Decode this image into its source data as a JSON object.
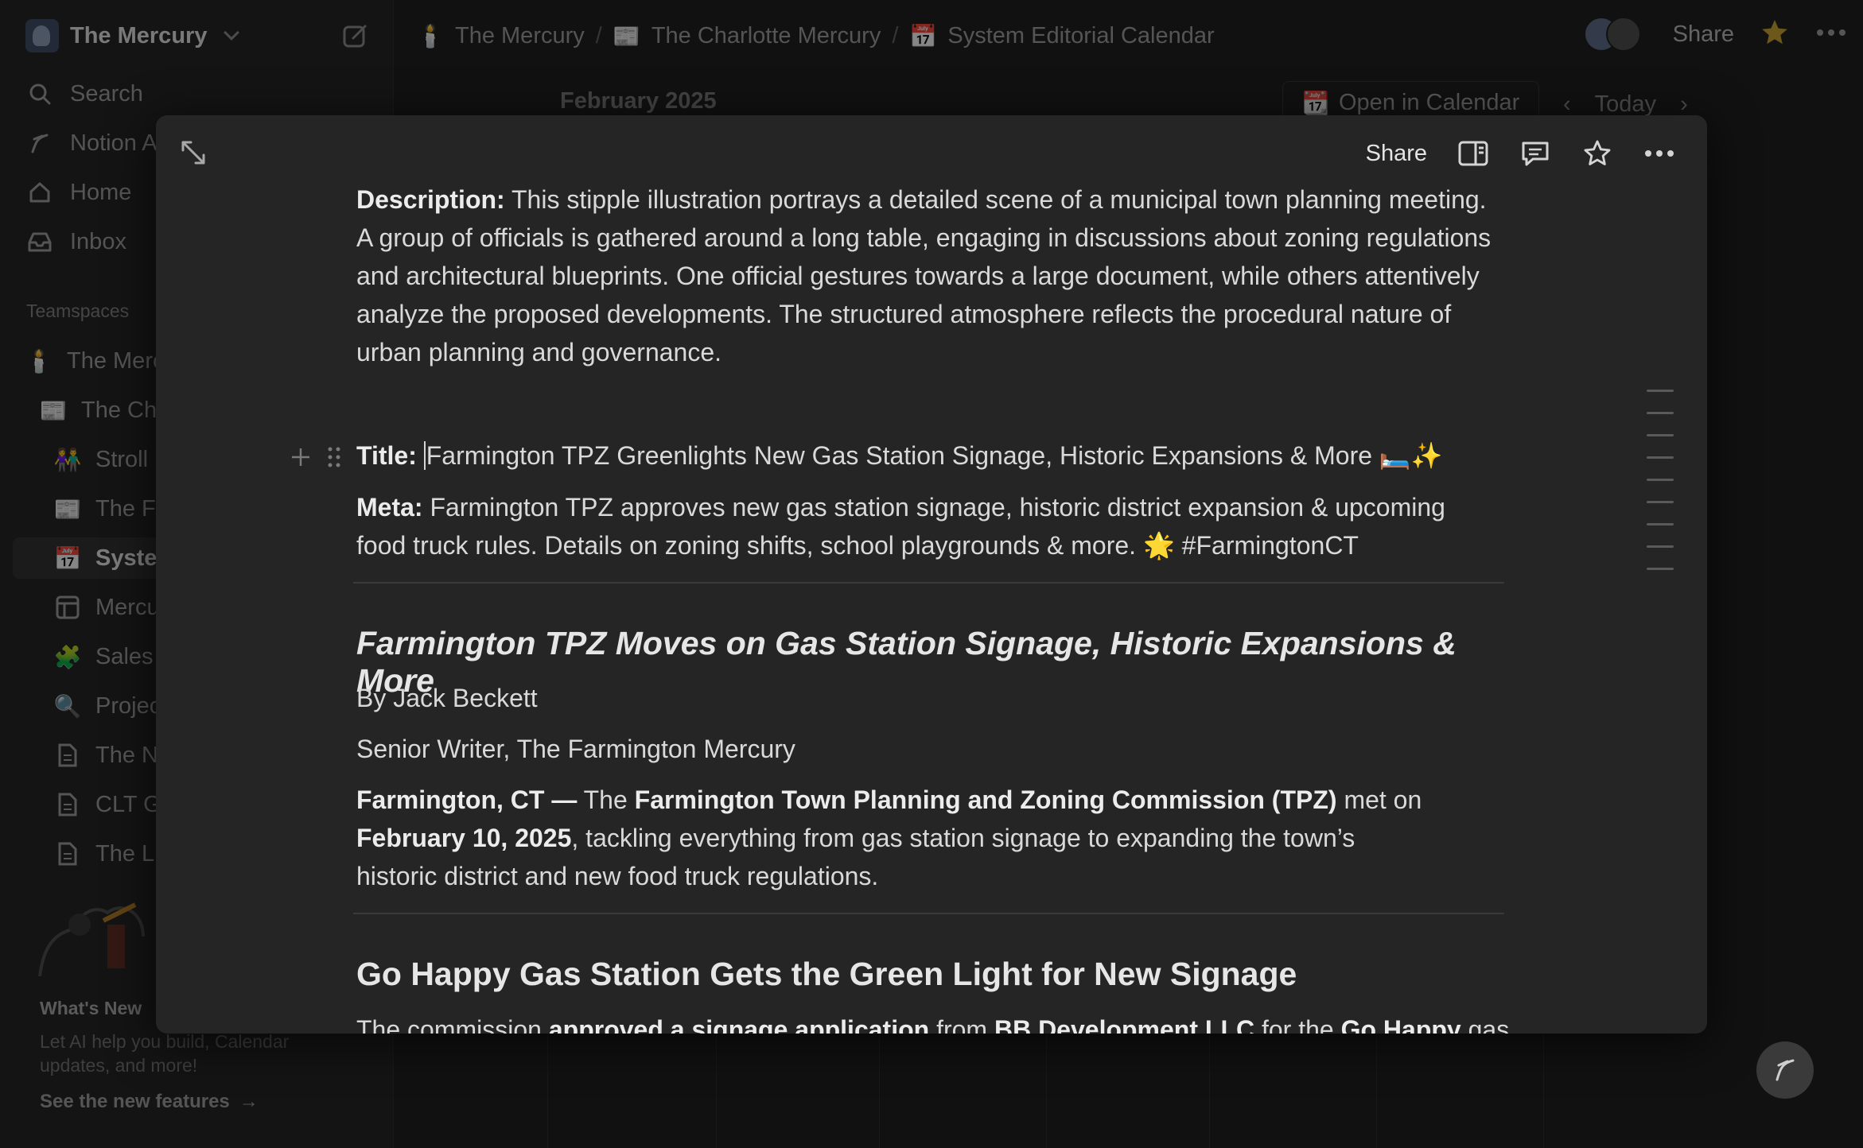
{
  "workspace": {
    "name": "The Mercury"
  },
  "sidebar": {
    "nav": [
      {
        "label": "Search",
        "icon": "search-icon"
      },
      {
        "label": "Notion AI",
        "icon": "notion-ai-icon"
      },
      {
        "label": "Home",
        "icon": "home-icon"
      },
      {
        "label": "Inbox",
        "icon": "inbox-icon"
      }
    ],
    "teamspaces_label": "Teamspaces",
    "teamspaces": [
      {
        "label": "The Mercury",
        "icon": "🕯️"
      },
      {
        "label": "The Charlotte Mercury",
        "icon": "📰"
      },
      {
        "label": "Stroll",
        "icon": "👫"
      },
      {
        "label": "The F",
        "icon": "📰"
      },
      {
        "label": "System Editorial Calendar",
        "icon": "📅"
      },
      {
        "label": "Mercury",
        "icon": "table"
      },
      {
        "label": "Sales",
        "icon": "🧩"
      },
      {
        "label": "Projects",
        "icon": "🔍"
      },
      {
        "label": "The N",
        "icon": "page"
      },
      {
        "label": "CLT G",
        "icon": "page"
      },
      {
        "label": "The L",
        "icon": "page"
      }
    ],
    "whats_new": {
      "title": "What's New",
      "text": "Let AI help you build, Calendar updates, and more!",
      "link": "See the new features"
    }
  },
  "breadcrumb": [
    {
      "label": "The Mercury",
      "icon": "🕯️"
    },
    {
      "label": "The Charlotte Mercury",
      "icon": "📰"
    },
    {
      "label": "System Editorial Calendar",
      "icon": "📅"
    }
  ],
  "topbar": {
    "share": "Share"
  },
  "calendar": {
    "month": "February 2025",
    "open_button": "Open in Calendar",
    "today": "Today"
  },
  "modal": {
    "share": "Share",
    "description_label": "Description:",
    "description_text": "This stipple illustration portrays a detailed scene of a municipal town planning meeting. A group of officials is gathered around a long table, engaging in discussions about zoning regulations and architectural blueprints. One official gestures towards a large document, while others attentively analyze the proposed developments. The structured atmosphere reflects the procedural nature of urban planning and governance.",
    "title_label": "Title:",
    "title_text": "Farmington TPZ Greenlights New Gas Station Signage, Historic Expansions & More 🛏️✨",
    "meta_label": "Meta:",
    "meta_text": "Farmington TPZ approves new gas station signage, historic district expansion & upcoming food truck rules. Details on zoning shifts, school playgrounds & more. 🌟 #FarmingtonCT",
    "headline": "Farmington TPZ Moves on Gas Station Signage, Historic Expansions & More",
    "byline": "By Jack Beckett",
    "role": "Senior Writer, The Farmington Mercury",
    "lede_dateline": "Farmington, CT —",
    "lede_the": "The",
    "lede_org": "Farmington Town Planning and Zoning Commission (TPZ)",
    "lede_met_on": "met on",
    "lede_date": "February 10, 2025",
    "lede_rest": ", tackling everything from gas station signage to expanding the town’s historic district and new food truck regulations.",
    "section_heading": "Go Happy Gas Station Gets the Green Light for New Signage",
    "para_start": "The commission",
    "para_b1": "approved a signage application",
    "para_from": "from",
    "para_b2": "BB Development LLC",
    "para_for": "for the",
    "para_b3": "Go Happy",
    "para_end": "gas"
  }
}
